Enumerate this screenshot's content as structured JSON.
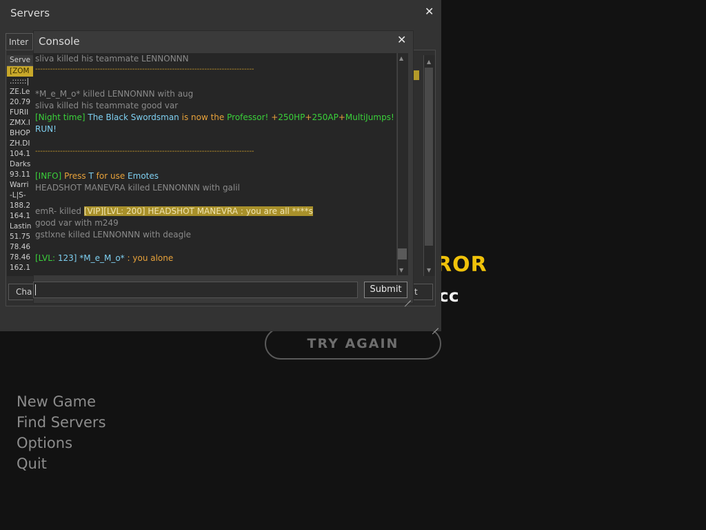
{
  "background": {
    "menu": [
      "New Game",
      "Find Servers",
      "Options",
      "Quit"
    ],
    "title_fragment": "ROR",
    "subtitle_fragment": "cc",
    "try_again": "TRY AGAIN",
    "title_color": "#f0c20a"
  },
  "servers_window": {
    "title": "Servers",
    "close": "✕",
    "tab_label": "Inter",
    "column_header": "Serve",
    "servers": [
      "[ZOM",
      ".::::::|",
      "ZE.Le",
      "20.79",
      "FURII",
      "ZMX.I",
      "BHOP",
      "ZH.DI",
      "104.1",
      "Darks",
      "93.11",
      "Warri",
      "-L|S-",
      "188.2",
      "164.1",
      "Lastin",
      "51.75",
      "78.46",
      "78.46",
      "162.1"
    ],
    "selected_index": 0,
    "button_left": "Cha",
    "button_right": "t"
  },
  "console": {
    "title": "Console",
    "close": "✕",
    "submit_label": "Submit",
    "input_value": "",
    "lines": {
      "l1": "sliva killed his teammate LENNONNN",
      "sep1": "----------------------------------------------------------------------------------------",
      "l2": "*M_e_M_o* killed LENNONNN with aug",
      "l3": "sliva killed his teammate good var",
      "l4a": "[Night time]",
      "l4b": "The Black Swordsman",
      "l4c": "is now the",
      "l4d": "Professor!",
      "l4e": "+",
      "l4f": "250HP",
      "l4g": "+",
      "l4h": "250AP",
      "l4i": "+",
      "l4j": "MultiJumps!",
      "l5": "RUN!",
      "sep2": "----------------------------------------------------------------------------------------",
      "l6a": "[INFO]",
      "l6b": "Press",
      "l6c": "T",
      "l6d": "for use",
      "l6e": "Emotes",
      "l7": "HEADSHOT MANEVRA killed LENNONNN with galil",
      "l8a": "emR- killed",
      "l8b": "[VIP][LVL: 200] HEADSHOT MANEVRA : you are all ****s",
      "l9": "good var with m249",
      "l10": "gstlxne killed LENNONNN with deagle",
      "l11a": "[LVL:",
      "l11b": "123]",
      "l11c": "*M_e_M_o*",
      "l11d": ": you alone"
    }
  },
  "icons": {
    "scroll_up": "▲",
    "scroll_down": "▼"
  }
}
